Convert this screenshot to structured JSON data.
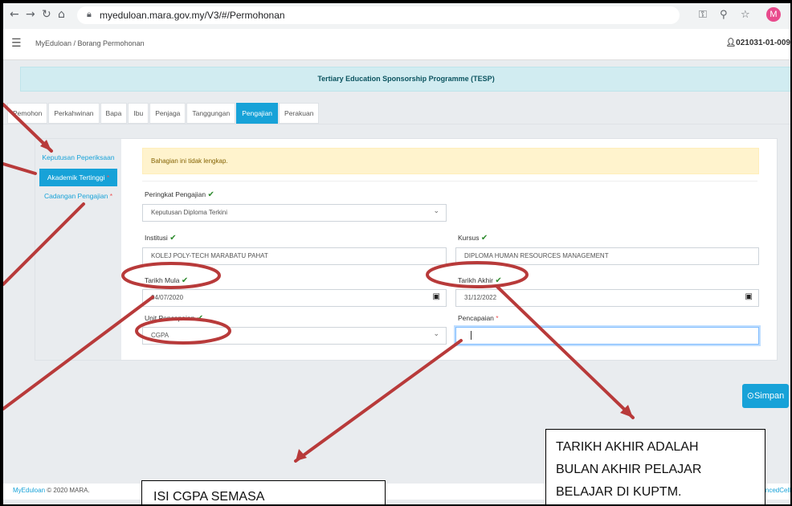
{
  "browser": {
    "url": "myeduloan.mara.gov.my/V3/#/Permohonan",
    "profile_initial": "M"
  },
  "header": {
    "breadcrumb": "MyEduloan / Borang Permohonan",
    "user_id": "021031-01-009"
  },
  "banner": "Tertiary Education Sponsorship Programme (TESP)",
  "tabs": [
    "Pemohon",
    "Perkahwinan",
    "Bapa",
    "Ibu",
    "Penjaga",
    "Tanggungan",
    "Pengajian",
    "Perakuan"
  ],
  "active_tab": "Pengajian",
  "sidenav": {
    "item1": "Keputusan Peperiksaan",
    "item2": "Akademik Tertinggi",
    "item3": "Cadangan Pengajian"
  },
  "form": {
    "alert": "Bahagian ini tidak lengkap.",
    "peringkat_label": "Peringkat Pengajian",
    "peringkat_value": "Keputusan Diploma Terkini",
    "institusi_label": "Institusi",
    "institusi_value": "KOLEJ POLY-TECH MARABATU PAHAT",
    "kursus_label": "Kursus",
    "kursus_value": "DIPLOMA HUMAN RESOURCES MANAGEMENT",
    "tarikh_mula_label": "Tarikh Mula",
    "tarikh_mula_value": "04/07/2020",
    "tarikh_akhir_label": "Tarikh Akhir",
    "tarikh_akhir_value": "31/12/2022",
    "unit_label": "Unit Pencapaian",
    "unit_value": "CGPA",
    "pencapaian_label": "Pencapaian",
    "pencapaian_value": ""
  },
  "save_label": "Simpan",
  "footer": {
    "brand": "MyEduloan",
    "rest": " ©  2020 MARA.",
    "right": "ancedCell"
  },
  "annotations": {
    "note1": "ISI CGPA SEMASA",
    "note2_line1": "TARIKH AKHIR ADALAH",
    "note2_line2": "BULAN AKHIR PELAJAR",
    "note2_line3": "BELAJAR DI KUPTM."
  },
  "colors": {
    "accent": "#17a2d8",
    "annotation": "#b83a3a",
    "alert_bg": "#fff3cd",
    "banner_bg": "#d1ecf1"
  }
}
